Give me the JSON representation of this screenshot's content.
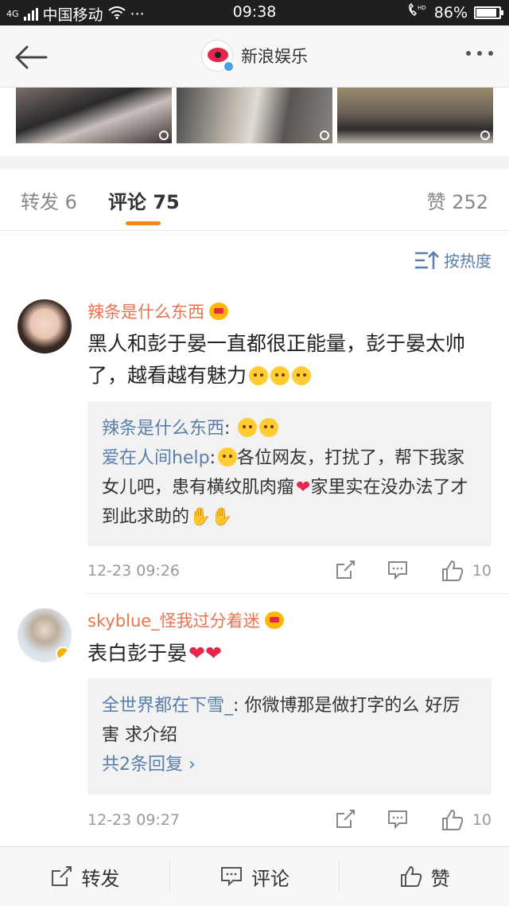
{
  "status_bar": {
    "carrier": "中国移动",
    "network": "4G",
    "time": "09:38",
    "battery": "86%",
    "icon_names": [
      "signal-icon",
      "wifi-icon",
      "more-dots-icon",
      "hd-call-icon",
      "battery-icon"
    ]
  },
  "nav": {
    "title": "新浪娱乐"
  },
  "tabs": {
    "repost": "转发 6",
    "comment": "评论 75",
    "like": "赞 252"
  },
  "sort_label": "按热度",
  "comments": [
    {
      "name": "辣条是什么东西",
      "text": "黑人和彭于晏一直都很正能量，彭于晏太帅了，越看越有魅力",
      "replies": [
        {
          "name": "辣条是什么东西",
          "sep": ":",
          "text": ""
        },
        {
          "name": "爱在人间help",
          "sep": ":",
          "text": "各位网友，打扰了，帮下我家女儿吧，患有横纹肌肉瘤",
          "text2": "家里实在没办法了才到此求助的"
        }
      ],
      "time": "12-23 09:26",
      "likes": "10"
    },
    {
      "name": "skyblue_怪我过分着迷",
      "text": "表白彭于晏",
      "replies": [
        {
          "name": "全世界都在下雪_",
          "sep": ":",
          "text": " 你微博那是做打字的么 好厉害 求介绍"
        }
      ],
      "more_replies": "共2条回复 ›",
      "time": "12-23 09:27",
      "likes": "10"
    }
  ],
  "bottom_bar": {
    "repost": "转发",
    "comment": "评论",
    "like": "赞"
  },
  "colors": {
    "accent": "#f08a1d",
    "username": "#eb7350",
    "link": "#5a7ea8"
  }
}
